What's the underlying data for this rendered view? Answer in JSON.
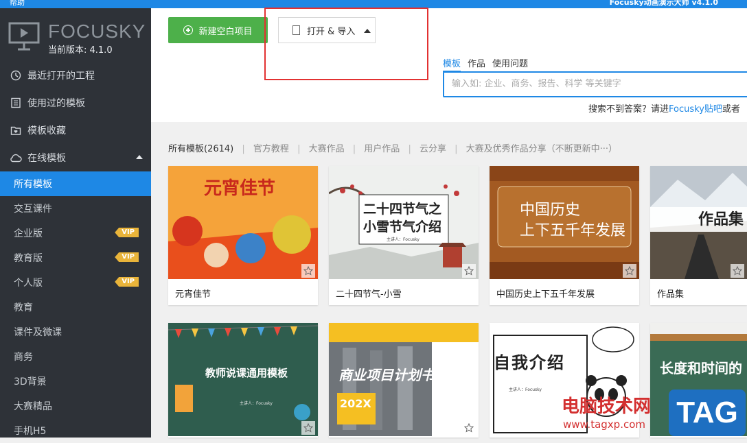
{
  "titlebar": {
    "help": "帮助",
    "app_title": "Focusky动画演示大师 v4.1.0"
  },
  "sidebar": {
    "brand": "FOCUSKY",
    "version": "当前版本: 4.1.0",
    "sections": [
      {
        "label": "最近打开的工程",
        "icon": "clock-icon"
      },
      {
        "label": "使用过的模板",
        "icon": "list-icon"
      },
      {
        "label": "模板收藏",
        "icon": "heart-folder-icon"
      },
      {
        "label": "在线模板",
        "icon": "cloud-icon"
      }
    ],
    "items": [
      {
        "label": "所有模板"
      },
      {
        "label": "交互课件"
      },
      {
        "label": "企业版",
        "badge": "VIP"
      },
      {
        "label": "教育版",
        "badge": "VIP"
      },
      {
        "label": "个人版",
        "badge": "VIP"
      },
      {
        "label": "教育"
      },
      {
        "label": "课件及微课"
      },
      {
        "label": "商务"
      },
      {
        "label": "3D背景"
      },
      {
        "label": "大赛精品"
      },
      {
        "label": "手机H5"
      }
    ]
  },
  "toolbar": {
    "new_label": "新建空白项目",
    "open_label": "打开 & 导入"
  },
  "search": {
    "tabs": [
      "模板",
      "作品",
      "使用问题"
    ],
    "placeholder": "输入如: 企业、商务、报告、科学 等关键字",
    "help_prefix": "搜索不到答案？请进",
    "help_link": "Focusky贴吧",
    "help_suffix": "或者"
  },
  "filters": {
    "all": "所有模板(2614)",
    "items": [
      "官方教程",
      "大赛作品",
      "用户作品",
      "云分享",
      "大赛及优秀作品分享（不断更新中···）"
    ]
  },
  "templates": [
    {
      "title": "元宵佳节",
      "thumb_text": "元宵佳节"
    },
    {
      "title": "二十四节气-小雪",
      "thumb_text": "二十四节气之",
      "thumb_text2": "小雪节气介绍",
      "thumb_sub": "主讲人：Focusky"
    },
    {
      "title": "中国历史上下五千年发展",
      "thumb_text": "中国历史",
      "thumb_text2": "上下五千年发展"
    },
    {
      "title": "作品集",
      "thumb_text": "作品集"
    },
    {
      "title": "",
      "thumb_text": "教师说课通用模板",
      "thumb_sub": "主讲人：Focusky"
    },
    {
      "title": "",
      "thumb_text": "商业项目计划书",
      "thumb_sub": "202X"
    },
    {
      "title": "",
      "thumb_text": "自我介绍",
      "thumb_sub": "主讲人：Focusky"
    },
    {
      "title": "",
      "thumb_text": "长度和时间的"
    }
  ],
  "watermark": {
    "text": "电脑技术网",
    "url": "www.tagxp.com",
    "tag": "TAG"
  },
  "colors": {
    "accent": "#1e88e5",
    "sidebar_bg": "#2e3238",
    "new_button": "#4db04a",
    "vip": "#e9b43a",
    "highlight": "#e23131"
  }
}
